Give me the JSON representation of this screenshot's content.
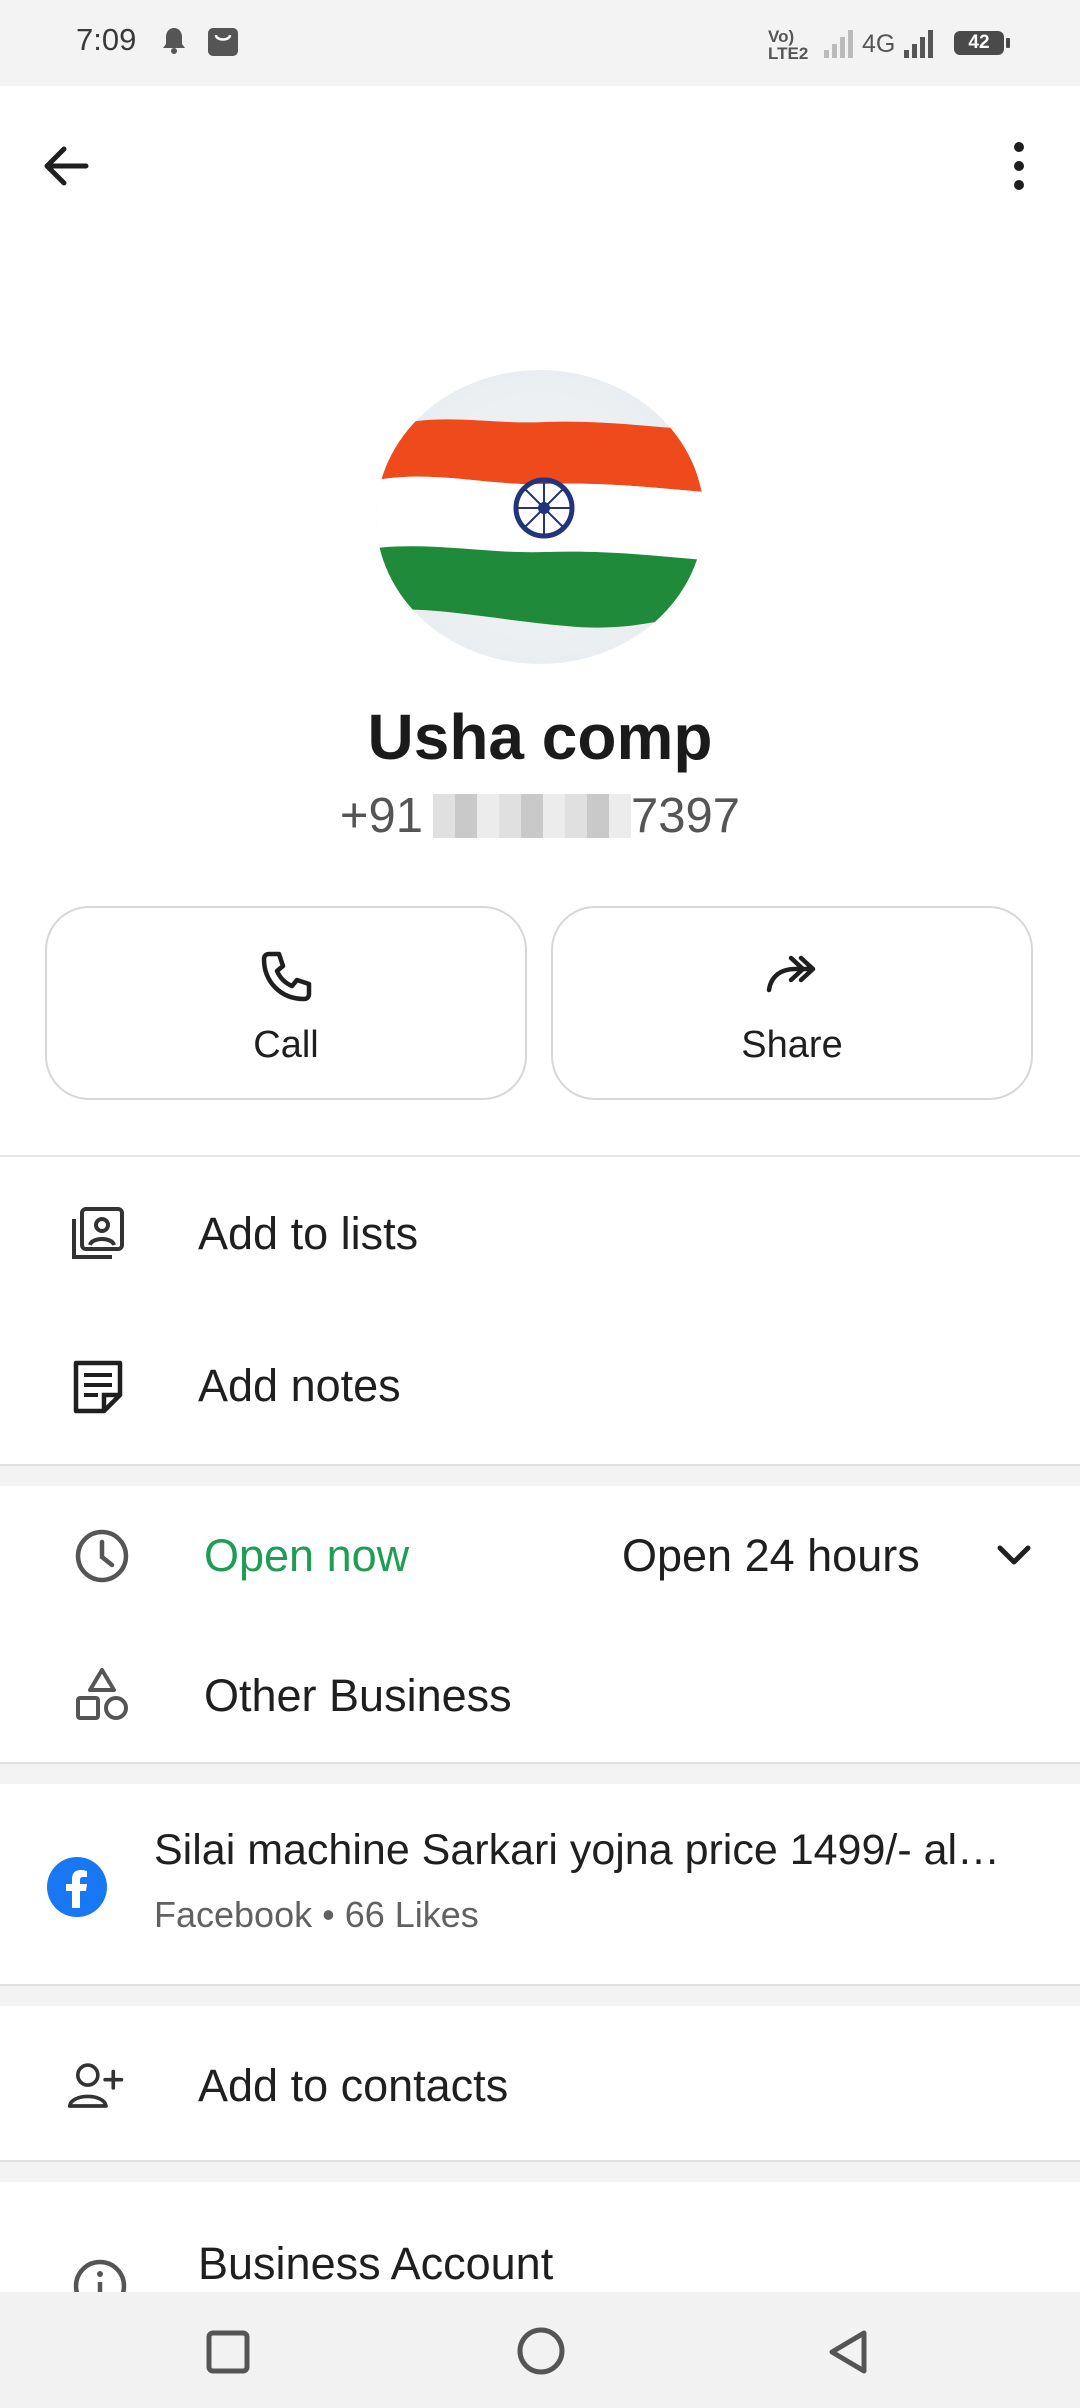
{
  "status_bar": {
    "time": "7:09",
    "network": "4G",
    "volte": "Vo) LTE2",
    "battery": "42",
    "icons": [
      "notification-icon",
      "shopping-bag-icon",
      "signal-icon",
      "battery-icon"
    ]
  },
  "header": {
    "back_icon": "arrow-left-icon",
    "more_icon": "more-vertical-icon"
  },
  "contact": {
    "name": "Usha comp",
    "phone_prefix": "+91",
    "phone_suffix": "7397"
  },
  "actions": [
    {
      "label": "Call",
      "icon": "phone-icon"
    },
    {
      "label": "Share",
      "icon": "share-icon"
    }
  ],
  "menu": {
    "add_to_lists": "Add to lists",
    "add_notes": "Add notes"
  },
  "business": {
    "status": "Open now",
    "hours": "Open 24 hours",
    "category": "Other Business"
  },
  "facebook": {
    "title": "Silai machine Sarkari yojna price 1499/- al…",
    "source": "Facebook",
    "likes": "66 Likes"
  },
  "add_to_contacts": "Add to contacts",
  "business_account": "Business Account",
  "colors": {
    "accent_green": "#1f9d55",
    "facebook_blue": "#1877f2"
  }
}
